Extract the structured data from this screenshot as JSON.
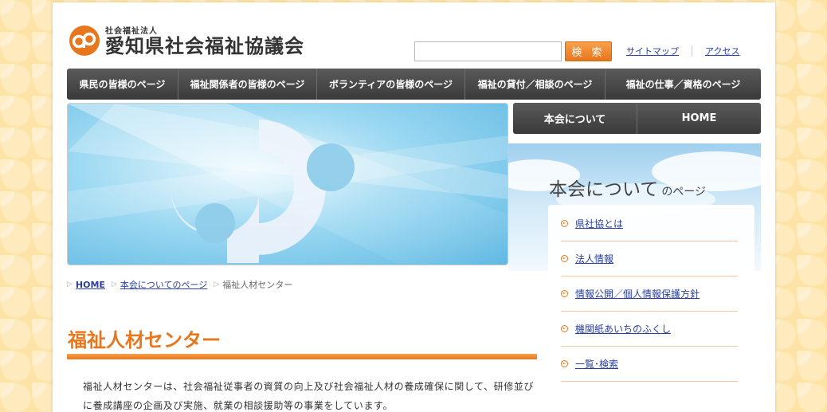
{
  "header": {
    "org_type": "社会福祉法人",
    "org_name": "愛知県社会福祉協議会",
    "search_placeholder": "",
    "search_button": "検 索",
    "util_links": [
      "サイトマップ",
      "アクセス"
    ]
  },
  "global_nav": [
    "県民の皆様のページ",
    "福祉関係者の皆様のページ",
    "ボランティアの皆様のページ",
    "福祉の貸付／相談のページ",
    "福祉の仕事／資格のページ"
  ],
  "side_buttons": [
    "本会について",
    "HOME"
  ],
  "side_panel": {
    "title": "本会について",
    "title_suffix": "のページ",
    "items": [
      "県社協とは",
      "法人情報",
      "情報公開／個人情報保護方針",
      "機関紙あいちのふくし",
      "一覧･検索"
    ]
  },
  "breadcrumb": {
    "home": "HOME",
    "parent": "本会についてのページ",
    "current": "福祉人材センター"
  },
  "main": {
    "title": "福祉人材センター",
    "body": "福祉人材センターは、社会福祉従事者の資質の向上及び社会福祉人材の養成確保に関して、研修並びに養成講座の企画及び実施、就業の相談援助等の事業をしています。"
  },
  "colors": {
    "accent": "#e8761c",
    "nav_bg": "#444444",
    "link": "#2a3fa0",
    "page_bg": "#fde3a6"
  }
}
